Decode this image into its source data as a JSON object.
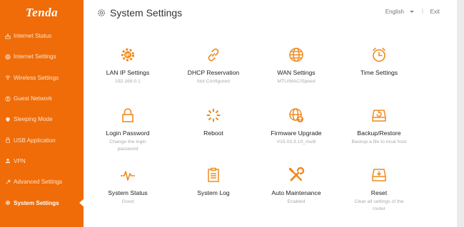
{
  "brand": "Tenda",
  "sidebar": {
    "items": [
      {
        "label": "Internet Status",
        "icon": "globe-status-icon"
      },
      {
        "label": "Internet Settings",
        "icon": "globe-icon"
      },
      {
        "label": "Wireless Settings",
        "icon": "wifi-icon"
      },
      {
        "label": "Guest Network",
        "icon": "guest-icon"
      },
      {
        "label": "Sleeping Mode",
        "icon": "sleep-icon"
      },
      {
        "label": "USB Application",
        "icon": "usb-icon"
      },
      {
        "label": "VPN",
        "icon": "vpn-icon"
      },
      {
        "label": "Advanced Settings",
        "icon": "wrench-icon"
      },
      {
        "label": "System Settings",
        "icon": "gear-icon",
        "active": true
      }
    ]
  },
  "header": {
    "title": "System Settings",
    "language": "English",
    "separator": "|",
    "exit": "Exit"
  },
  "tiles": [
    {
      "label": "LAN IP Settings",
      "sub": "192.168.0.1",
      "icon": "lan-ip-icon"
    },
    {
      "label": "DHCP Reservation",
      "sub": "Not Configured",
      "icon": "link-icon"
    },
    {
      "label": "WAN Settings",
      "sub": "MTU/MAC/Speed",
      "icon": "globe-icon"
    },
    {
      "label": "Time Settings",
      "sub": "",
      "icon": "clock-icon"
    },
    {
      "label": "Login Password",
      "sub": "Change the login\npassword",
      "icon": "lock-icon"
    },
    {
      "label": "Reboot",
      "sub": "",
      "icon": "reboot-icon"
    },
    {
      "label": "Firmware Upgrade",
      "sub": "V15.03.3.10_multi",
      "icon": "firmware-upgrade-icon"
    },
    {
      "label": "Backup/Restore",
      "sub": "Backup a file to local host",
      "icon": "backup-icon"
    },
    {
      "label": "System Status",
      "sub": "Good",
      "icon": "pulse-icon"
    },
    {
      "label": "System Log",
      "sub": "",
      "icon": "log-icon"
    },
    {
      "label": "Auto Maintenance",
      "sub": "Enabled",
      "icon": "tools-icon"
    },
    {
      "label": "Reset",
      "sub": "Clear all settings of the\nrouter",
      "icon": "reset-icon"
    }
  ],
  "colors": {
    "brand_orange": "#ef6c08",
    "icon_orange": "#f08a1e"
  }
}
